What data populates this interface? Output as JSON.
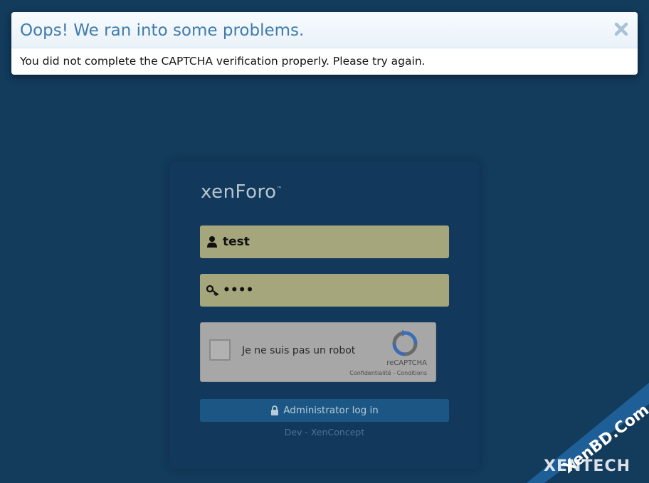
{
  "error": {
    "title": "Oops! We ran into some problems.",
    "message": "You did not complete the CAPTCHA verification properly. Please try again.",
    "close_icon": "close-icon"
  },
  "login": {
    "logo": "xenForo",
    "logo_mark": "™",
    "username": {
      "value": "test",
      "icon": "user-icon"
    },
    "password": {
      "value": "test",
      "icon": "key-icon"
    },
    "recaptcha": {
      "label": "Je ne suis pas un robot",
      "brand": "reCAPTCHA",
      "privacy_link": "Confidentialité",
      "separator": "-",
      "terms_link": "Conditions"
    },
    "submit_label": "Administrator log in",
    "submit_icon": "lock-icon",
    "footer": "Dev - XenConcept"
  },
  "watermark": {
    "line1": "XenBD.Com",
    "line2": "XENTECH"
  },
  "colors": {
    "background": "#123b5c",
    "field": "#a6a67c",
    "button": "#1b5684",
    "title": "#3f7cab"
  }
}
